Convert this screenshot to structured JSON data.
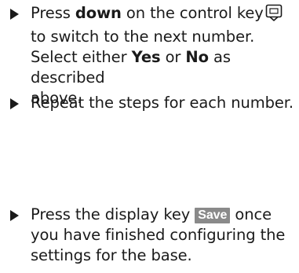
{
  "steps": [
    {
      "p1": "Press ",
      "b1": "down",
      "p2": " on the control key",
      "icon": "control-key-down-icon",
      "line2": "to switch to the next number.",
      "p3": "Select either ",
      "b2": "Yes",
      "p4": " or ",
      "b3": "No",
      "p5": " as described",
      "line4": "above."
    },
    {
      "text": "Repeat the steps for each number."
    },
    {
      "p1": "Press the display key ",
      "key": "Save",
      "p2": " once",
      "line2": "you have finished configuring the",
      "line3": "settings for the base."
    }
  ]
}
